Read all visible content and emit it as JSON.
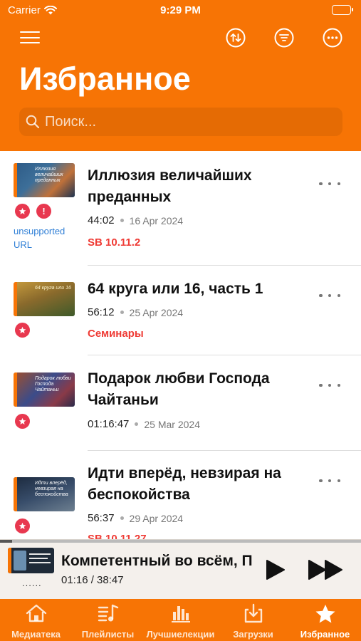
{
  "status_bar": {
    "carrier": "Carrier",
    "time": "9:29 PM"
  },
  "header": {
    "title": "Избранное",
    "icons": [
      "menu-icon",
      "sort-icon",
      "filter-icon",
      "more-icon"
    ],
    "search_placeholder": "Поиск..."
  },
  "colors": {
    "accent": "#f77405",
    "favorite": "#e8384f",
    "reference": "#ef3b35",
    "link": "#2f7fd6"
  },
  "items": [
    {
      "title": "Иллюзия величайших преданных",
      "thumb_caption": "Иллюзия величайших преданных",
      "duration": "44:02",
      "date": "16 Apr 2024",
      "reference": "SB 10.11.2",
      "warning": "!",
      "warning_text": "unsupported URL"
    },
    {
      "title": "64 круга или 16, часть 1",
      "thumb_caption": "64 круга или 16",
      "duration": "56:12",
      "date": "25 Apr 2024",
      "reference": "Семинары"
    },
    {
      "title": "Подарок любви Господа Чайтаньи",
      "thumb_caption": "Подарок любви Господа Чайтаньи",
      "duration": "01:16:47",
      "date": "25 Mar 2024"
    },
    {
      "title": "Идти вперёд, невзирая на беспокойства",
      "thumb_caption": "Идти вперёд, невзирая на беспокойства",
      "duration": "56:37",
      "date": "29 Apr 2024",
      "reference": "SB 10.11.27"
    }
  ],
  "player": {
    "title": "Компетентный во всём, П",
    "time": "01:16 / 38:47",
    "dots": "......",
    "progress": 0.033
  },
  "tabs": [
    {
      "label": "Медиатека",
      "icon": "home-icon"
    },
    {
      "label": "Плейлисты",
      "icon": "playlist-icon"
    },
    {
      "label": "Лучшиелекции",
      "icon": "chart-icon"
    },
    {
      "label": "Загрузки",
      "icon": "download-icon"
    },
    {
      "label": "Избранное",
      "icon": "star-icon",
      "active": true
    }
  ]
}
